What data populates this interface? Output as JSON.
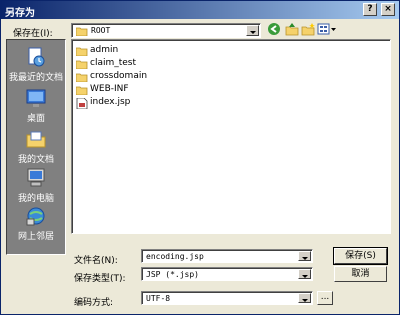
{
  "window": {
    "title": "另存为",
    "controls": {
      "help": "?",
      "close": "×"
    }
  },
  "save_in": {
    "label": "保存在(I):",
    "value": "ROOT"
  },
  "places_bar": {
    "items": [
      {
        "label": "我最近的文档",
        "icon": "recent-documents-icon"
      },
      {
        "label": "桌面",
        "icon": "desktop-icon"
      },
      {
        "label": "我的文档",
        "icon": "my-documents-icon"
      },
      {
        "label": "我的电脑",
        "icon": "my-computer-icon"
      },
      {
        "label": "网上邻居",
        "icon": "network-places-icon"
      }
    ]
  },
  "files": [
    {
      "name": "admin",
      "type": "folder"
    },
    {
      "name": "claim_test",
      "type": "folder"
    },
    {
      "name": "crossdomain",
      "type": "folder"
    },
    {
      "name": "WEB-INF",
      "type": "folder"
    },
    {
      "name": "index.jsp",
      "type": "file"
    }
  ],
  "form": {
    "filename_label": "文件名(N):",
    "filename_value": "encoding.jsp",
    "filetype_label": "保存类型(T):",
    "filetype_value": "JSP (*.jsp)",
    "encoding_label": "编码方式:",
    "encoding_value": "UTF-8",
    "browse_label": "..."
  },
  "buttons": {
    "save": "保存(S)",
    "cancel": "取消"
  },
  "colors": {
    "title_start": "#0a246a",
    "title_end": "#a6caf0",
    "dialog_bg": "#ece9d8",
    "folder_yellow": "#f5d26b"
  }
}
